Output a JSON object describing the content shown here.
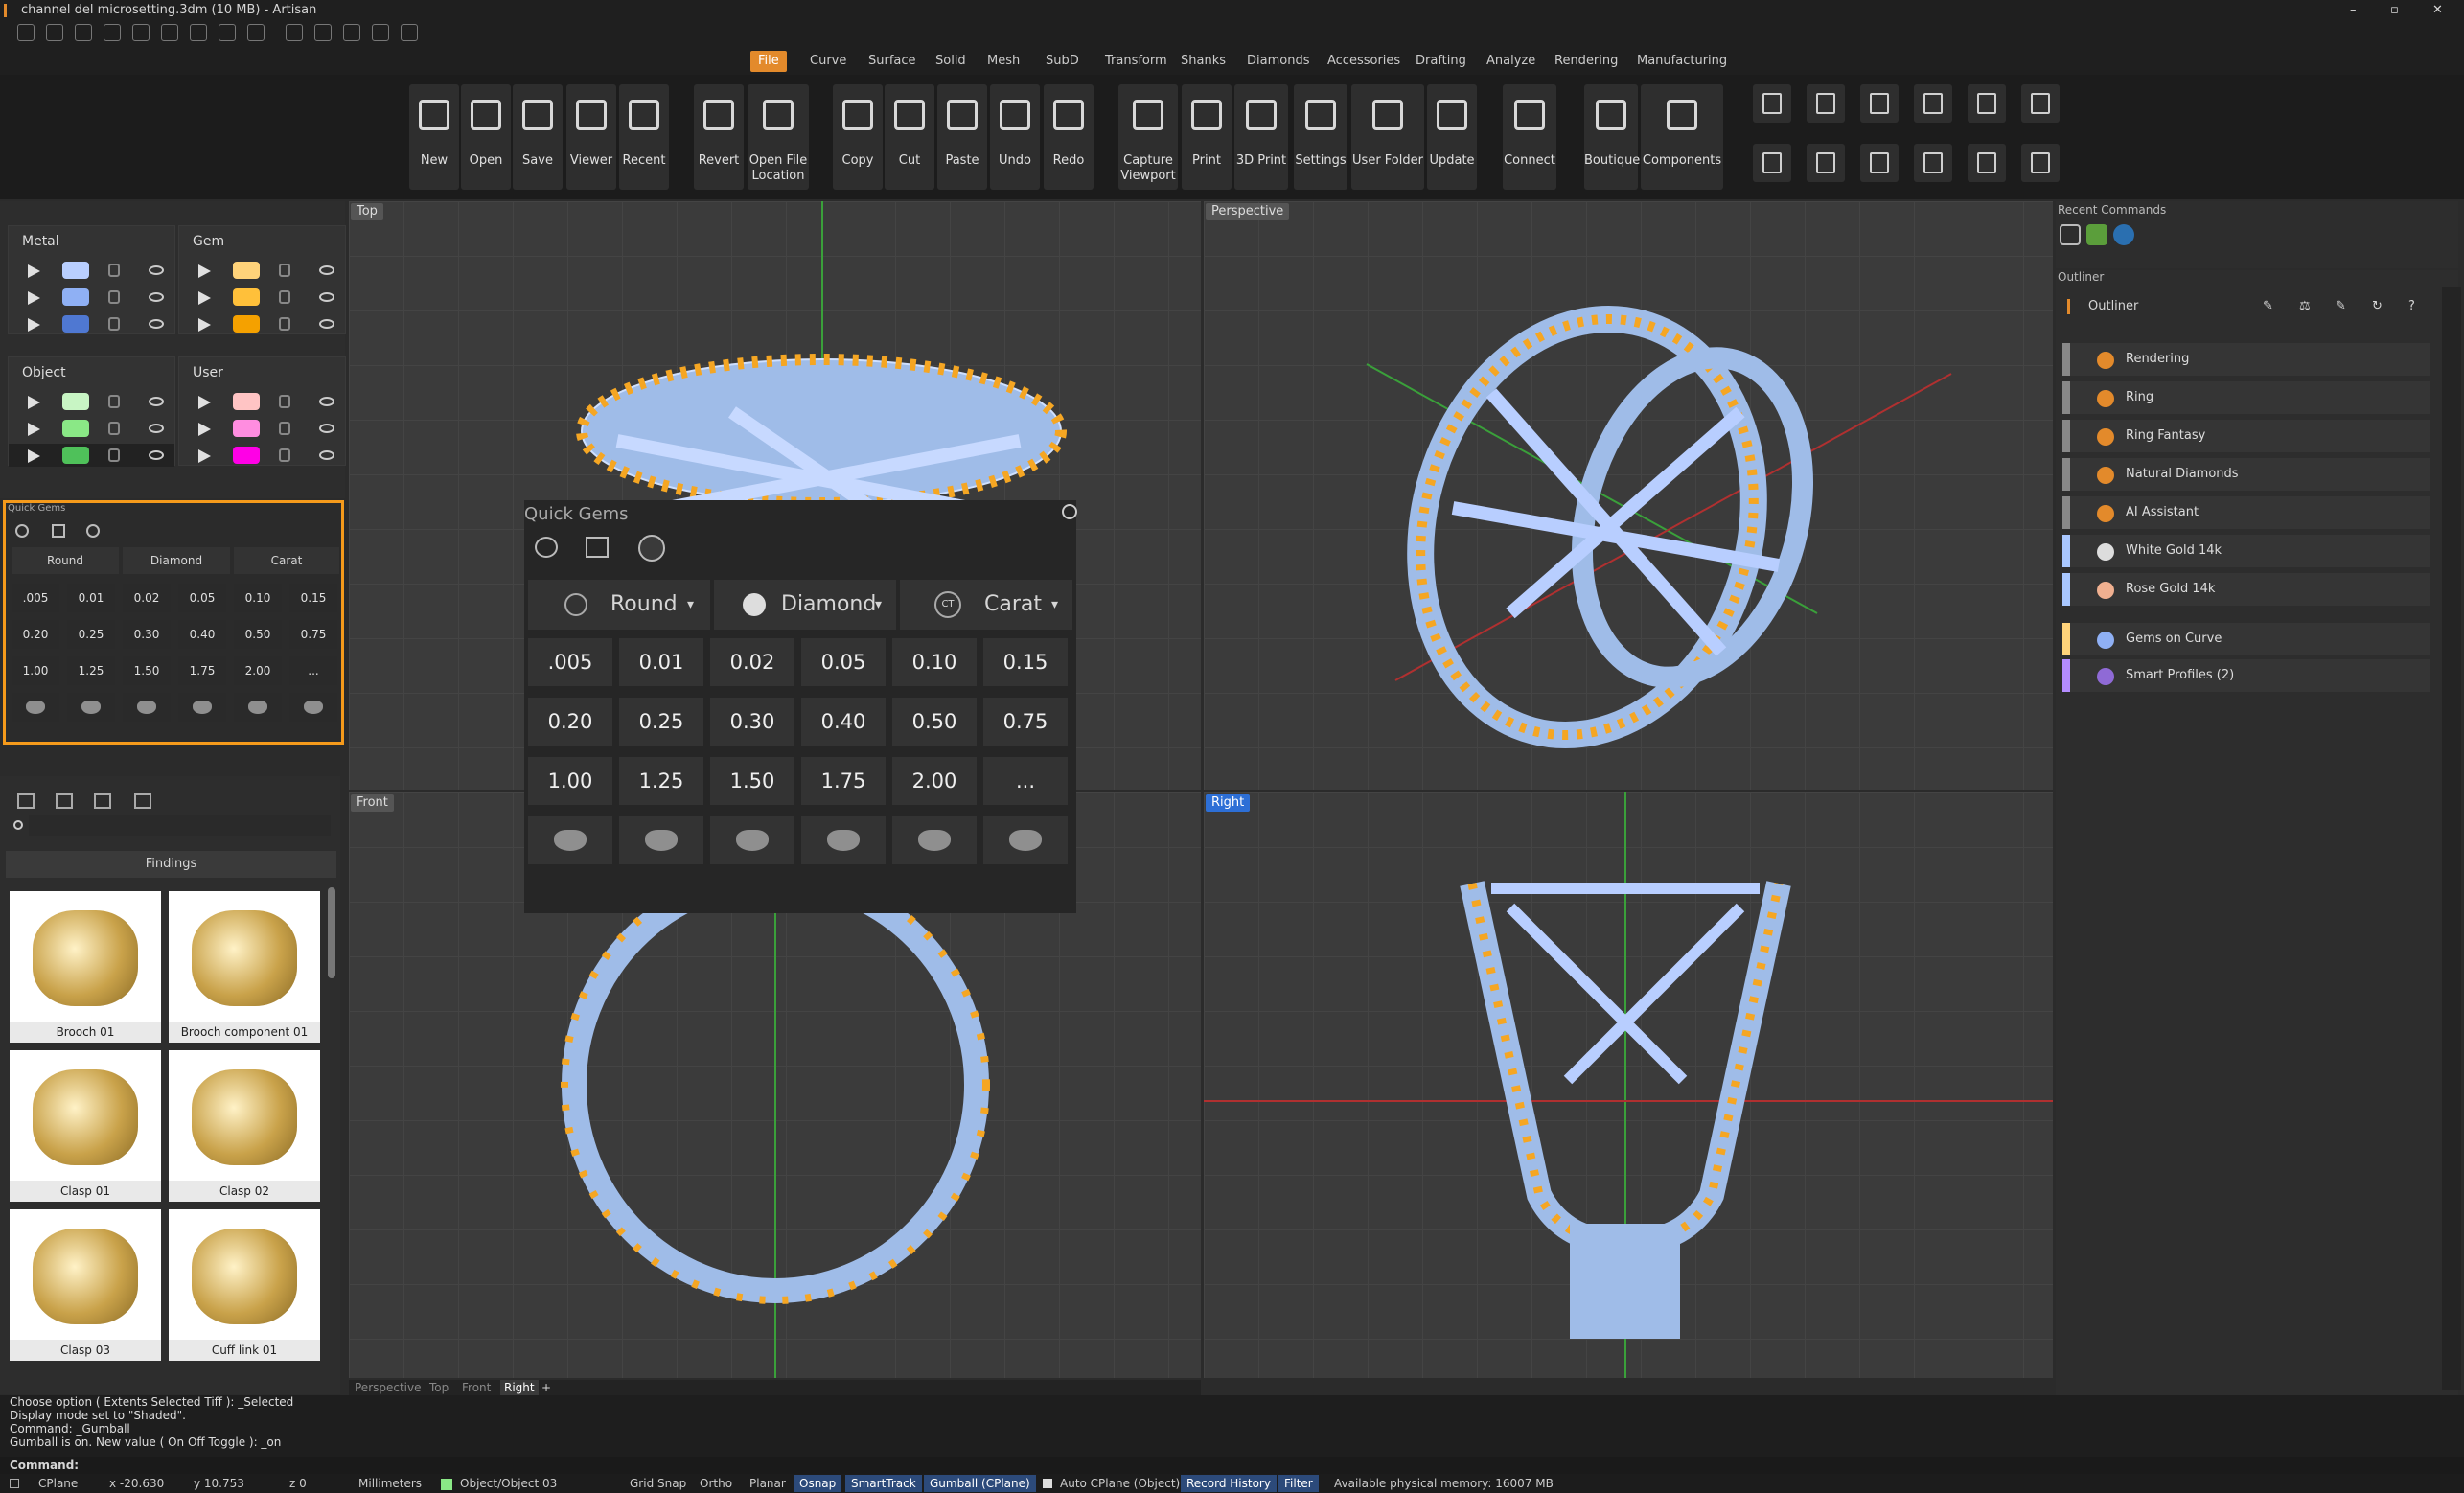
{
  "window": {
    "title": "channel del microsetting.3dm (10 MB) - Artisan"
  },
  "menu_tabs": [
    "File",
    "Curve",
    "Surface",
    "Solid",
    "Mesh",
    "SubD",
    "Transform",
    "Shanks",
    "Diamonds",
    "Accessories",
    "Drafting",
    "Analyze",
    "Rendering",
    "Manufacturing"
  ],
  "ribbon": {
    "buttons": [
      "New",
      "Open",
      "Save",
      "Viewer",
      "Recent",
      "Revert",
      "Open File Location",
      "Copy",
      "Cut",
      "Paste",
      "Undo",
      "Redo",
      "Capture Viewport",
      "Print",
      "3D Print",
      "Settings",
      "User Folder",
      "Update",
      "Connect",
      "Boutique",
      "Components"
    ]
  },
  "layers": {
    "metal": {
      "title": "Metal",
      "colors": [
        "#b9cfff",
        "#8fb0f4",
        "#4f78d2"
      ]
    },
    "gem": {
      "title": "Gem",
      "colors": [
        "#ffd37a",
        "#ffc03a",
        "#f5a100"
      ]
    },
    "object": {
      "title": "Object",
      "colors": [
        "#c8f5c4",
        "#8ae886",
        "#4fc15a"
      ]
    },
    "user": {
      "title": "User",
      "colors": [
        "#ffc4c4",
        "#ff8de0",
        "#ff00e6"
      ]
    }
  },
  "quick_gems": {
    "title": "Quick Gems",
    "shape": "Round",
    "material": "Diamond",
    "unit": "Carat",
    "sizes": [
      ".005",
      "0.01",
      "0.02",
      "0.05",
      "0.10",
      "0.15",
      "0.20",
      "0.25",
      "0.30",
      "0.40",
      "0.50",
      "0.75",
      "1.00",
      "1.25",
      "1.50",
      "1.75",
      "2.00",
      "..."
    ]
  },
  "library": {
    "category": "Findings",
    "items": [
      "Brooch 01",
      "Brooch component 01",
      "Clasp 01",
      "Clasp 02",
      "Clasp 03",
      "Cuff link 01"
    ]
  },
  "viewports": {
    "top": "Top",
    "perspective": "Perspective",
    "front": "Front",
    "right": "Right"
  },
  "viewport_tabs": [
    "Perspective",
    "Top",
    "Front",
    "Right"
  ],
  "recent_commands": {
    "title": "Recent Commands"
  },
  "outliner": {
    "panel_title": "Outliner",
    "header": "Outliner",
    "items": [
      {
        "label": "Rendering",
        "bar": "#888",
        "icon": "#e38a2b"
      },
      {
        "label": "Ring",
        "bar": "#888",
        "icon": "#e38a2b"
      },
      {
        "label": "Ring Fantasy",
        "bar": "#888",
        "icon": "#e38a2b"
      },
      {
        "label": "Natural Diamonds",
        "bar": "#888",
        "icon": "#e38a2b"
      },
      {
        "label": "AI Assistant",
        "bar": "#888",
        "icon": "#e38a2b"
      },
      {
        "label": "White Gold 14k",
        "bar": "#a9c7ff",
        "icon": "#ddd"
      },
      {
        "label": "Rose Gold 14k",
        "bar": "#a9c7ff",
        "icon": "#f0b090"
      },
      {
        "label": "Gems on Curve",
        "bar": "#ffd37a",
        "icon": "#8fb0f4"
      },
      {
        "label": "Smart Profiles (2)",
        "bar": "#b48cff",
        "icon": "#8f6ad6"
      }
    ]
  },
  "command_history": [
    "Choose option ( Extents  Selected  Tiff ): _Selected",
    "Display mode set to \"Shaded\".",
    "Command: _Gumball",
    "Gumball is on. New value ( On  Off  Toggle ): _on"
  ],
  "command_prompt": "Command:",
  "status": {
    "cplane": "CPlane",
    "x": "x -20.630",
    "y": "y 10.753",
    "z": "z 0",
    "units": "Millimeters",
    "layer": "Object/Object 03",
    "grid_snap": "Grid Snap",
    "ortho": "Ortho",
    "planar": "Planar",
    "osnap": "Osnap",
    "smarttrack": "SmartTrack",
    "gumball": "Gumball (CPlane)",
    "auto_cplane": "Auto CPlane (Object)",
    "record_history": "Record History",
    "filter": "Filter",
    "memory": "Available physical memory: 16007 MB"
  }
}
